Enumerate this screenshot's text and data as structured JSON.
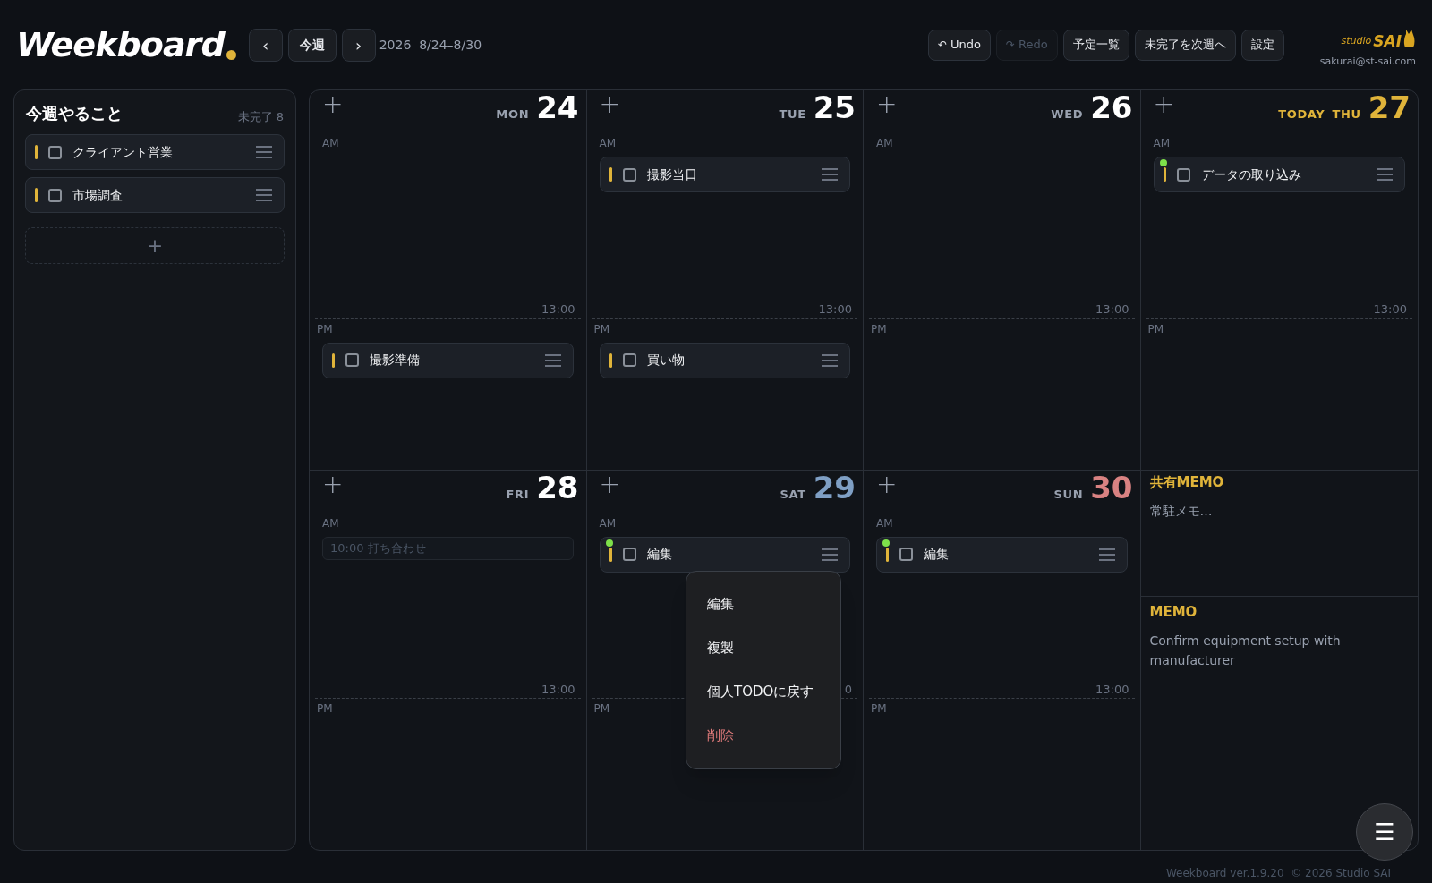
{
  "header": {
    "logo": "Weekboard",
    "nav": {
      "prev": "‹",
      "today": "今週",
      "next": "›"
    },
    "range": "2026  8/24–8/30",
    "actions": [
      {
        "label": "Undo",
        "icon": "↶",
        "disabled": false
      },
      {
        "label": "Redo",
        "icon": "↷",
        "disabled": true
      },
      {
        "label": "予定一覧",
        "disabled": false
      },
      {
        "label": "未完了を次週へ",
        "disabled": false
      },
      {
        "label": "設定",
        "disabled": false
      }
    ],
    "brand": {
      "studio": "studio",
      "name": "SAI",
      "email": "sakurai@st-sai.com"
    }
  },
  "sidebar": {
    "title": "今週やること",
    "count": "未完了 8",
    "add": "+",
    "tasks": [
      {
        "label": "クライアント営業",
        "checked": false
      },
      {
        "label": "市場調査",
        "checked": false
      }
    ]
  },
  "days": [
    {
      "dow": "MON",
      "date": "24",
      "kind": "weekday",
      "today": false,
      "add": "+",
      "am": "AM",
      "pm": "PM",
      "split": "13:00",
      "pm_items": [
        {
          "kind": "task",
          "label": "撮影準備",
          "checked": false,
          "dot": false
        }
      ]
    },
    {
      "dow": "TUE",
      "date": "25",
      "kind": "weekday",
      "today": false,
      "add": "+",
      "am": "AM",
      "pm": "PM",
      "split": "13:00",
      "am_items": [
        {
          "kind": "task",
          "label": "撮影当日",
          "checked": false,
          "dot": false
        }
      ],
      "pm_items": [
        {
          "kind": "task",
          "label": "買い物",
          "checked": false,
          "dot": false
        }
      ]
    },
    {
      "dow": "WED",
      "date": "26",
      "kind": "weekday",
      "today": false,
      "add": "+",
      "am": "AM",
      "pm": "PM",
      "split": "13:00"
    },
    {
      "dow": "THU",
      "date": "27",
      "kind": "weekday",
      "today": true,
      "today_label": "TODAY",
      "add": "+",
      "am": "AM",
      "pm": "PM",
      "split": "13:00",
      "am_items": [
        {
          "kind": "task",
          "label": "データの取り込み",
          "checked": false,
          "dot": true
        }
      ]
    },
    {
      "dow": "FRI",
      "date": "28",
      "kind": "weekday",
      "today": false,
      "add": "+",
      "am": "AM",
      "pm": "PM",
      "split": "13:00",
      "am_items": [
        {
          "kind": "event",
          "label": "10:00 打ち合わせ"
        }
      ]
    },
    {
      "dow": "SAT",
      "date": "29",
      "kind": "saturday",
      "today": false,
      "add": "+",
      "am": "AM",
      "pm": "PM",
      "split": "0",
      "am_items": [
        {
          "kind": "task",
          "label": "編集",
          "checked": false,
          "dot": true
        }
      ]
    },
    {
      "dow": "SUN",
      "date": "30",
      "kind": "sunday",
      "today": false,
      "add": "+",
      "am": "AM",
      "pm": "PM",
      "split": "13:00",
      "am_items": [
        {
          "kind": "task",
          "label": "編集",
          "checked": false,
          "dot": true
        }
      ]
    }
  ],
  "memos": [
    {
      "title": "共有MEMO",
      "text": "常駐メモ…"
    },
    {
      "title": "MEMO",
      "text": "Confirm equipment setup with manufacturer"
    }
  ],
  "context_menu": [
    {
      "label": "編集",
      "kind": "normal"
    },
    {
      "label": "複製",
      "kind": "normal"
    },
    {
      "label": "個人TODOに戻す",
      "kind": "normal"
    },
    {
      "label": "削除",
      "kind": "danger"
    }
  ],
  "fab": "☰",
  "footer": "Weekboard ver.1.9.20  © 2026 Studio SAI"
}
